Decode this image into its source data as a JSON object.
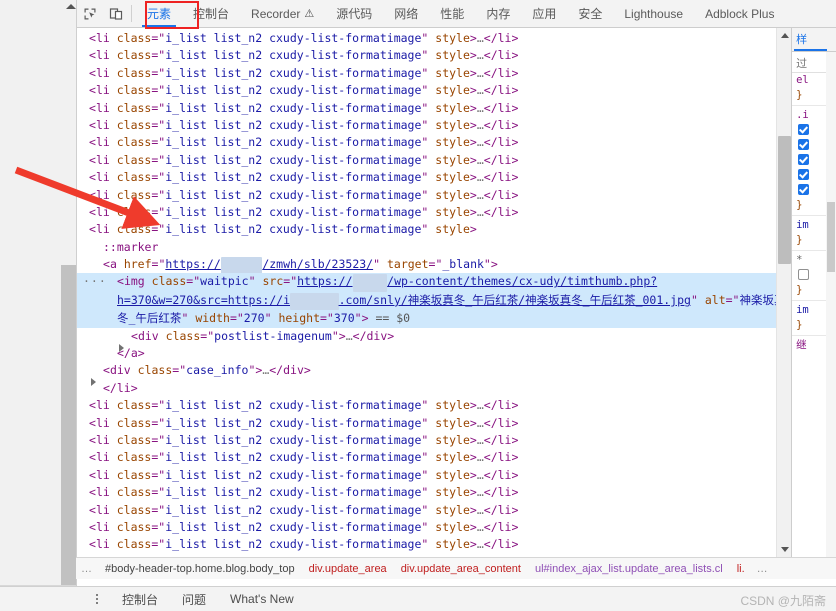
{
  "devtools": {
    "toolbar": {
      "inspect_icon": "inspect-element-icon",
      "device_icon": "device-toolbar-icon"
    },
    "tabs": [
      {
        "label": "元素",
        "active": true,
        "warn": false
      },
      {
        "label": "控制台",
        "active": false,
        "warn": false
      },
      {
        "label": "Recorder",
        "active": false,
        "warn": true,
        "warn_glyph": "⚠"
      },
      {
        "label": "源代码",
        "active": false,
        "warn": false
      },
      {
        "label": "网络",
        "active": false,
        "warn": false
      },
      {
        "label": "性能",
        "active": false,
        "warn": false
      },
      {
        "label": "内存",
        "active": false,
        "warn": false
      },
      {
        "label": "应用",
        "active": false,
        "warn": false
      },
      {
        "label": "安全",
        "active": false,
        "warn": false
      },
      {
        "label": "Lighthouse",
        "active": false,
        "warn": false
      },
      {
        "label": "Adblock Plus",
        "active": false,
        "warn": false
      }
    ],
    "annotation": {
      "tab_box_color": "#ee2222",
      "arrow_color": "#ef3b2c"
    }
  },
  "tree": {
    "collapsed_li": {
      "tag": "li",
      "attr_class": "class",
      "class_value": "i_list list_n2 cxudy-list-formatimage",
      "attr_style": "style",
      "ellipsis": "…",
      "close": "</li>"
    },
    "expanded": {
      "li_open_tag": "li",
      "li_class_attr": "class",
      "li_class_value": "i_list list_n2 cxudy-list-formatimage",
      "li_style_attr": "style",
      "marker": "::marker",
      "a_tag": "a",
      "a_href_attr": "href",
      "a_href_prefix": "https://",
      "a_href_blur": "▆▆▆▆▆▆",
      "a_href_suffix": "/zmwh/slb/23523/",
      "a_target_attr": "target",
      "a_target_value": "_blank",
      "img_tag": "img",
      "img_class_attr": "class",
      "img_class_value": "waitpic",
      "img_src_attr": "src",
      "img_src_p1": "https://",
      "img_src_blur1": "▆▆▆▆▆",
      "img_src_p2": "/wp-content/themes/cx-udy/timthumb.php?h=370&w=270&src=https://i",
      "img_src_blur2": "▆▆▆▆▆▆▆",
      "img_src_p3": ".com/snly/神楽坂真冬_午后红茶/神楽坂真冬_午后红茶_001.jpg",
      "img_alt_attr": "alt",
      "img_alt_value": "神楽坂真冬_午后红茶",
      "img_width_attr": "width",
      "img_width_value": "270",
      "img_height_attr": "height",
      "img_height_value": "370",
      "img_badge": "== $0",
      "div_imagenum_tag": "div",
      "div_imagenum_class": "class",
      "div_imagenum_value": "postlist-imagenum",
      "div_imagenum_ellipsis": "…",
      "div_imagenum_close": "</div>",
      "a_close": "</a>",
      "div_caseinfo_tag": "div",
      "div_caseinfo_class": "class",
      "div_caseinfo_value": "case_info",
      "div_caseinfo_ellipsis": "…",
      "div_caseinfo_close": "</div>",
      "li_close": "</li>",
      "row_dots": "···"
    },
    "rows_above": 11,
    "rows_below": 11
  },
  "styles_pane": {
    "tab_label": "样",
    "filter_label": "过",
    "lines": [
      {
        "text": "el",
        "kind": "sel"
      },
      {
        "text": "}",
        "kind": "brace"
      },
      {
        "text": ".i",
        "kind": "sel"
      },
      {
        "text": "check",
        "kind": "check"
      },
      {
        "text": "check",
        "kind": "check"
      },
      {
        "text": "check",
        "kind": "check"
      },
      {
        "text": "check",
        "kind": "check"
      },
      {
        "text": "check",
        "kind": "check"
      },
      {
        "text": "}",
        "kind": "brace"
      },
      {
        "text": "im",
        "kind": "prop"
      },
      {
        "text": "}",
        "kind": "brace"
      },
      {
        "text": "*",
        "kind": "star"
      },
      {
        "text": "emptycheck",
        "kind": "emptycheck"
      },
      {
        "text": "}",
        "kind": "brace"
      },
      {
        "text": "im",
        "kind": "prop"
      },
      {
        "text": "}",
        "kind": "brace"
      },
      {
        "text": "继",
        "kind": "sel"
      }
    ]
  },
  "breadcrumb": {
    "leading_dots": "…",
    "items": [
      {
        "label": "#body-header-top.home.blog.body_top",
        "kind": "plain"
      },
      {
        "label": "div.update_area",
        "kind": "div"
      },
      {
        "label": "div.update_area_content",
        "kind": "div"
      },
      {
        "label": "ul#index_ajax_list.update_area_lists.cl",
        "kind": "ul"
      },
      {
        "label": "li.",
        "kind": "li"
      }
    ],
    "trailing_dots": "…"
  },
  "drawer": {
    "menu_icon": "kebab-menu-icon",
    "items": [
      "控制台",
      "问题",
      "What's New"
    ]
  },
  "watermark": {
    "text": "CSDN @九陌斋"
  }
}
